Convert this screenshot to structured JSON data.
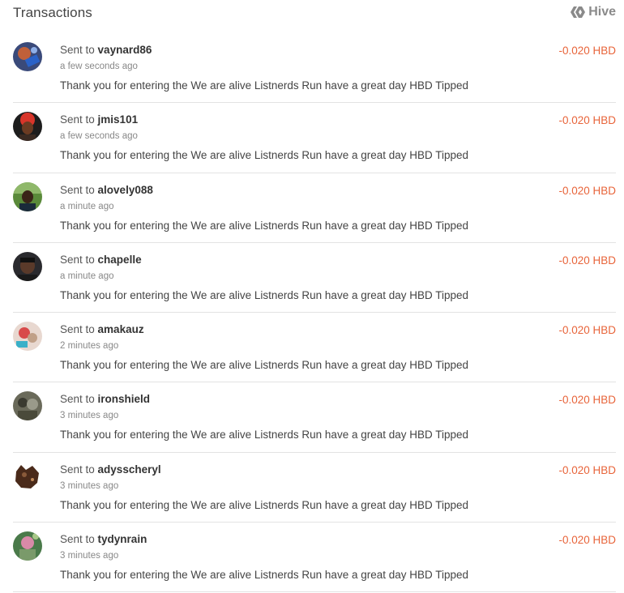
{
  "header": {
    "title": "Transactions",
    "brand_label": "Hive",
    "brand_icon": "hive-logo-icon"
  },
  "colors": {
    "amount": "#e8643a",
    "divider": "#e3e3e3",
    "muted_text": "#888888"
  },
  "transactions": [
    {
      "prefix": "Sent to",
      "user": "vaynard86",
      "time": "a few seconds ago",
      "memo": "Thank you for entering the We are alive Listnerds Run have a great day HBD Tipped",
      "amount": "-0.020 HBD",
      "avatar": "user-avatar"
    },
    {
      "prefix": "Sent to",
      "user": "jmis101",
      "time": "a few seconds ago",
      "memo": "Thank you for entering the We are alive Listnerds Run have a great day HBD Tipped",
      "amount": "-0.020 HBD",
      "avatar": "user-avatar"
    },
    {
      "prefix": "Sent to",
      "user": "alovely088",
      "time": "a minute ago",
      "memo": "Thank you for entering the We are alive Listnerds Run have a great day HBD Tipped",
      "amount": "-0.020 HBD",
      "avatar": "user-avatar"
    },
    {
      "prefix": "Sent to",
      "user": "chapelle",
      "time": "a minute ago",
      "memo": "Thank you for entering the We are alive Listnerds Run have a great day HBD Tipped",
      "amount": "-0.020 HBD",
      "avatar": "user-avatar"
    },
    {
      "prefix": "Sent to",
      "user": "amakauz",
      "time": "2 minutes ago",
      "memo": "Thank you for entering the We are alive Listnerds Run have a great day HBD Tipped",
      "amount": "-0.020 HBD",
      "avatar": "user-avatar"
    },
    {
      "prefix": "Sent to",
      "user": "ironshield",
      "time": "3 minutes ago",
      "memo": "Thank you for entering the We are alive Listnerds Run have a great day HBD Tipped",
      "amount": "-0.020 HBD",
      "avatar": "user-avatar"
    },
    {
      "prefix": "Sent to",
      "user": "adysscheryl",
      "time": "3 minutes ago",
      "memo": "Thank you for entering the We are alive Listnerds Run have a great day HBD Tipped",
      "amount": "-0.020 HBD",
      "avatar": "user-avatar"
    },
    {
      "prefix": "Sent to",
      "user": "tydynrain",
      "time": "3 minutes ago",
      "memo": "Thank you for entering the We are alive Listnerds Run have a great day HBD Tipped",
      "amount": "-0.020 HBD",
      "avatar": "user-avatar"
    }
  ]
}
